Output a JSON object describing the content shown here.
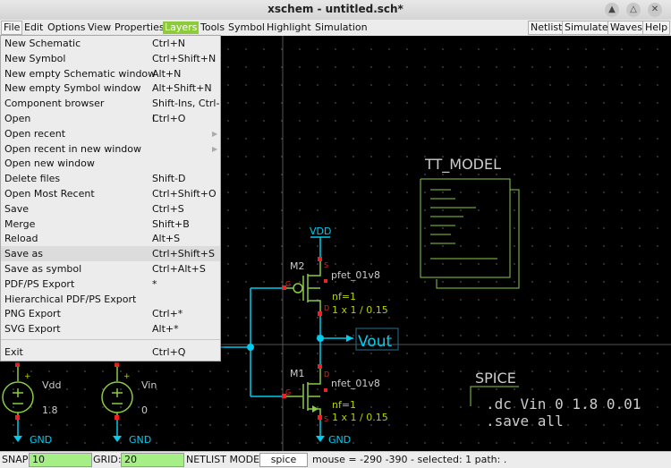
{
  "window": {
    "title": "xschem - untitled.sch*"
  },
  "menubar": {
    "file": "File",
    "edit": "Edit",
    "options": "Options",
    "view": "View",
    "properties": "Properties",
    "layers": "Layers",
    "tools": "Tools",
    "symbol": "Symbol",
    "highlight": "Highlight",
    "simulation": "Simulation",
    "netlist": "Netlist",
    "simulate": "Simulate",
    "waves": "Waves",
    "help": "Help"
  },
  "file_menu": [
    {
      "label": "New Schematic",
      "accel": "Ctrl+N"
    },
    {
      "label": "New Symbol",
      "accel": "Ctrl+Shift+N"
    },
    {
      "label": "New empty Schematic window",
      "accel": "Alt+N"
    },
    {
      "label": "New empty Symbol window",
      "accel": "Alt+Shift+N"
    },
    {
      "label": "Component browser",
      "accel": "Shift-Ins, Ctrl-I"
    },
    {
      "label": "Open",
      "accel": "Ctrl+O"
    },
    {
      "label": "Open recent",
      "accel": ""
    },
    {
      "label": "Open recent in new window",
      "accel": ""
    },
    {
      "label": "Open new window",
      "accel": ""
    },
    {
      "label": "Delete files",
      "accel": "Shift-D"
    },
    {
      "label": "Open Most Recent",
      "accel": "Ctrl+Shift+O"
    },
    {
      "label": "Save",
      "accel": "Ctrl+S"
    },
    {
      "label": "Merge",
      "accel": "Shift+B"
    },
    {
      "label": "Reload",
      "accel": "Alt+S"
    },
    {
      "label": "Save as",
      "accel": "Ctrl+Shift+S"
    },
    {
      "label": "Save as symbol",
      "accel": "Ctrl+Alt+S"
    },
    {
      "label": "PDF/PS Export",
      "accel": "*"
    },
    {
      "label": "Hierarchical PDF/PS Export",
      "accel": ""
    },
    {
      "label": "PNG Export",
      "accel": "Ctrl+*"
    },
    {
      "label": "SVG Export",
      "accel": "Alt+*"
    },
    {
      "label": "Exit",
      "accel": "Ctrl+Q"
    }
  ],
  "schematic": {
    "tt_model": "TT_MODEL",
    "vdd_label": "VDD",
    "m2": {
      "name": "M2",
      "model": "pfet_01v8",
      "nf": "nf=1",
      "size": "1 x 1 / 0.15",
      "g": "G",
      "s": "S",
      "d": "D"
    },
    "m1": {
      "name": "M1",
      "model": "nfet_01v8",
      "nf": "nf=1",
      "size": "1 x 1 / 0.15",
      "g": "G",
      "s": "S",
      "d": "D"
    },
    "vout": "Vout",
    "spice_title": "SPICE",
    "spice_line1": ".dc Vin 0 1.8 0.01",
    "spice_line2": ".save all",
    "vdd_src": {
      "name": "Vdd",
      "value": "1.8"
    },
    "vin_src": {
      "name": "Vin",
      "value": "0"
    },
    "gnd": "GND",
    "plus": "+"
  },
  "statusbar": {
    "snap_label": "SNAP:",
    "snap_value": "10",
    "grid_label": "GRID:",
    "grid_value": "20",
    "netlist_label": "NETLIST MODE:",
    "netlist_value": "spice",
    "info": "mouse = -290 -390 - selected: 1 path: ."
  },
  "colors": {
    "wire": "#00ccee",
    "text": "#cccccc",
    "model": "#b8d000",
    "pin": "#ee2222",
    "symbol": "#88cc44",
    "menu_highlight": "#8ecb3c",
    "field_green": "#a6ee86"
  }
}
